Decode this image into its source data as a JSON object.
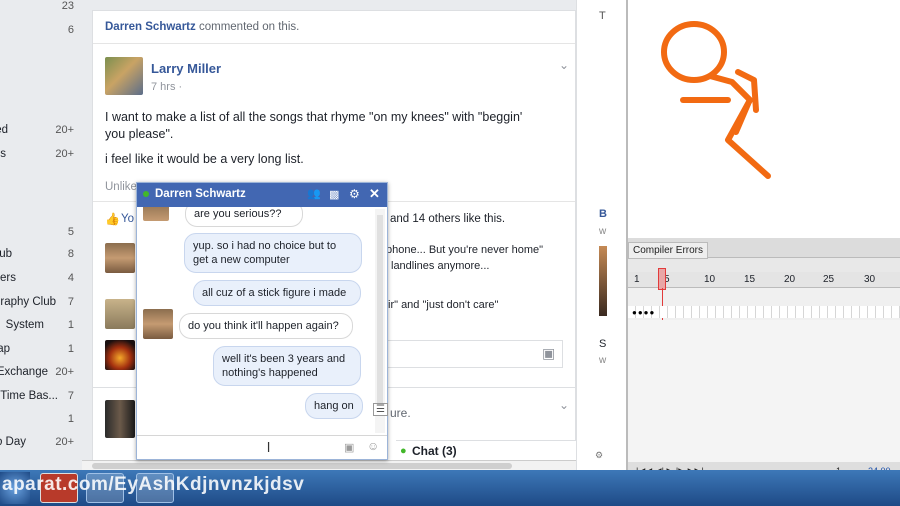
{
  "sidebar": {
    "items": [
      {
        "label": "",
        "count": "23"
      },
      {
        "label": "",
        "count": "6"
      },
      {
        "label": "ed",
        "count": "20+"
      },
      {
        "label": "s",
        "count": "20+"
      },
      {
        "label": "",
        "count": "5"
      },
      {
        "label": "ub",
        "count": "8"
      },
      {
        "label": "ers",
        "count": "4"
      },
      {
        "label": "raphy Club",
        "count": "7"
      },
      {
        "label": "System",
        "count": "1"
      },
      {
        "label": "ap",
        "count": "1"
      },
      {
        "label": "Exchange",
        "count": "20+"
      },
      {
        "label": "Time Bas...",
        "count": "7"
      },
      {
        "label": "",
        "count": "1"
      },
      {
        "label": "o Day",
        "count": "20+"
      }
    ]
  },
  "feed": {
    "activity": {
      "actor": "Darren Schwartz",
      "action": "commented on this."
    },
    "post": {
      "author": "Larry Miller",
      "time": "7 hrs",
      "text_1": "I want to make a list of all the songs that rhyme \"on my knees\" with \"beggin' you please\".",
      "text_2": "i feel like it would be a very long list.",
      "unlike": "Unlike",
      "likes_you": "Yo",
      "likes_rest": "and 14 others like this.",
      "comment_1a": "phone... But you're never home\"",
      "comment_1b": "landlines anymore...",
      "comment_2": "ir\" and \"just don't care\"",
      "partial_text": "ure."
    }
  },
  "chat": {
    "title": "Darren Schwartz",
    "messages": [
      {
        "from": "them",
        "text": "are you serious??"
      },
      {
        "from": "me",
        "text": "yup. so i had no choice but to get a new computer"
      },
      {
        "from": "me",
        "text": "all cuz of a stick figure i made"
      },
      {
        "from": "them",
        "text": "do you think it'll happen again?"
      },
      {
        "from": "me",
        "text": "well it's been 3 years and nothing's happened"
      },
      {
        "from": "me",
        "text": "hang on"
      }
    ],
    "dock_label": "Chat (3)"
  },
  "animate": {
    "panel_tab": "Compiler Errors",
    "timeline_numbers": [
      "1",
      "5",
      "10",
      "15",
      "20",
      "25",
      "30"
    ],
    "frame_counter": "1",
    "fps": "24.00 fp"
  },
  "right_col": {
    "labels": [
      "T",
      "B",
      "w",
      "S",
      "w"
    ]
  },
  "taskbar": {
    "watermark": "aparat.com/EyAshKdjnvnzkjdsv"
  },
  "colors": {
    "fb_blue": "#4267b2",
    "stick_figure": "#f26a12",
    "playhead": "#e23b3b"
  }
}
